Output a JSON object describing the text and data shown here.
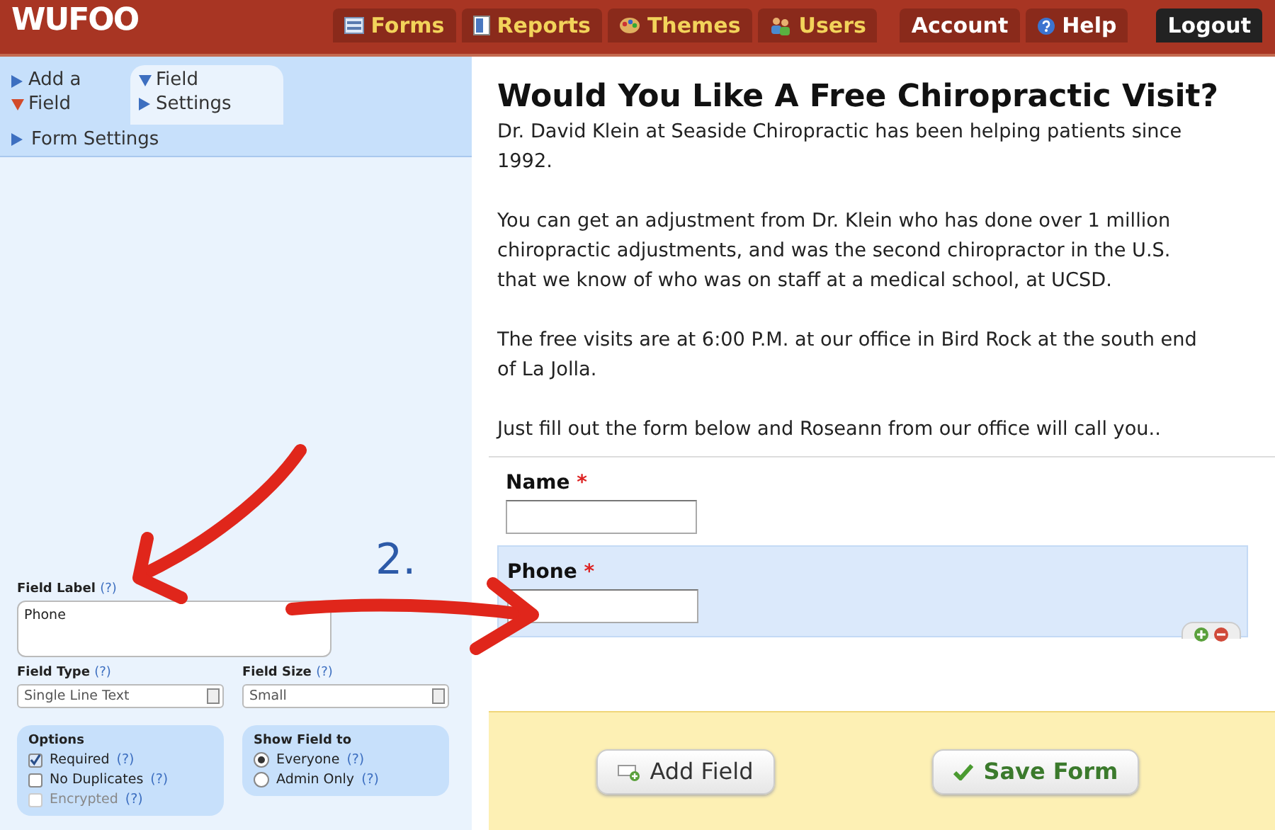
{
  "header": {
    "logo": "WUFOO",
    "nav": [
      {
        "label": "Forms",
        "kind": "forms"
      },
      {
        "label": "Reports",
        "kind": "reports"
      },
      {
        "label": "Themes",
        "kind": "themes"
      },
      {
        "label": "Users",
        "kind": "users"
      },
      {
        "label": "Account",
        "kind": "account"
      },
      {
        "label": "Help",
        "kind": "help"
      },
      {
        "label": "Logout",
        "kind": "logout"
      }
    ]
  },
  "sidebar": {
    "tabs": [
      {
        "label": "Add a Field",
        "selected": false
      },
      {
        "label": "Field Settings",
        "selected": true
      }
    ],
    "form_settings": "Form Settings",
    "field_label": {
      "label": "Field Label",
      "help": "(?)",
      "value": "Phone"
    },
    "field_type": {
      "label": "Field Type",
      "help": "(?)",
      "value": "Single Line Text"
    },
    "field_size": {
      "label": "Field Size",
      "help": "(?)",
      "value": "Small"
    },
    "options": {
      "title": "Options",
      "items": [
        {
          "label": "Required",
          "help": "(?)",
          "checked": true,
          "disabled": false
        },
        {
          "label": "No Duplicates",
          "help": "(?)",
          "checked": false,
          "disabled": false
        },
        {
          "label": "Encrypted",
          "help": "(?)",
          "checked": false,
          "disabled": true
        }
      ]
    },
    "show_field_to": {
      "title": "Show Field to",
      "items": [
        {
          "label": "Everyone",
          "help": "(?)",
          "selected": true
        },
        {
          "label": "Admin Only",
          "help": "(?)",
          "selected": false
        }
      ]
    }
  },
  "form": {
    "title": "Would You Like A Free Chiropractic Visit?",
    "paragraphs": [
      "Dr. David Klein at Seaside Chiropractic has been helping patients since 1992.",
      "You can get an adjustment from Dr. Klein who has done over 1 million chiropractic adjustments, and was the second chiropractor in the U.S. that we know of who was on staff at a medical school, at UCSD.",
      "The free visits are at 6:00 P.M. at our office in Bird Rock at the south end of La Jolla.",
      "Just fill out the form below and Roseann from our office will call you.."
    ],
    "fields": [
      {
        "label": "Name",
        "required_mark": "*",
        "selected": false
      },
      {
        "label": "Phone",
        "required_mark": "*",
        "selected": true
      }
    ],
    "buttons": [
      {
        "label": "Add Field",
        "kind": "add"
      },
      {
        "label": "Save Form",
        "kind": "save"
      }
    ]
  },
  "annotation": {
    "label": "2."
  }
}
